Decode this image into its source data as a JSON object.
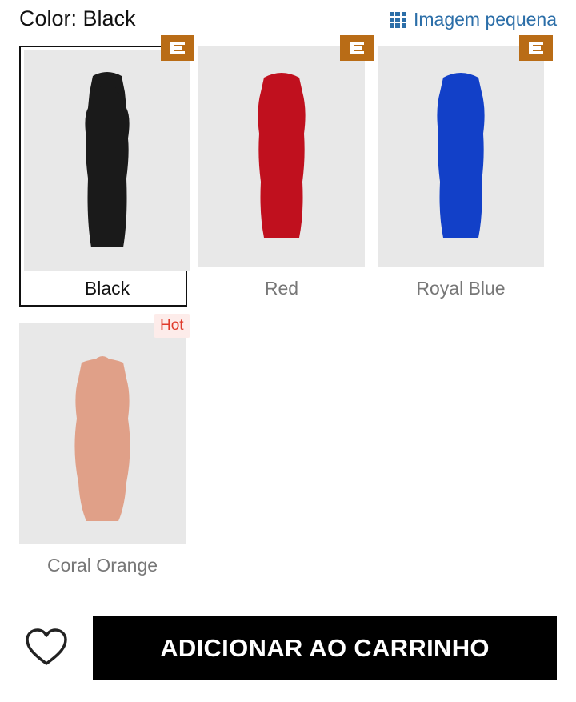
{
  "header": {
    "color_label": "Color: Black",
    "view_toggle_label": "Imagem pequena",
    "view_toggle_icon": "grid-icon"
  },
  "variants": [
    {
      "name": "Black",
      "color": "#1a1a1a",
      "selected": true,
      "badge": "e-badge"
    },
    {
      "name": "Red",
      "color": "#c0101e",
      "selected": false,
      "badge": "e-badge"
    },
    {
      "name": "Royal Blue",
      "color": "#1240c8",
      "selected": false,
      "badge": "e-badge"
    },
    {
      "name": "Coral Orange",
      "color": "#e0a088",
      "selected": false,
      "badge": "Hot"
    }
  ],
  "colors": {
    "accent_link": "#2b6ea8",
    "badge_e": "#b96c16",
    "hot_text": "#e03a2a",
    "hot_bg": "#fdecea",
    "image_bg": "#e8e8e8"
  },
  "actions": {
    "wishlist_icon": "heart-icon",
    "add_to_cart_label": "ADICIONAR AO CARRINHO"
  }
}
